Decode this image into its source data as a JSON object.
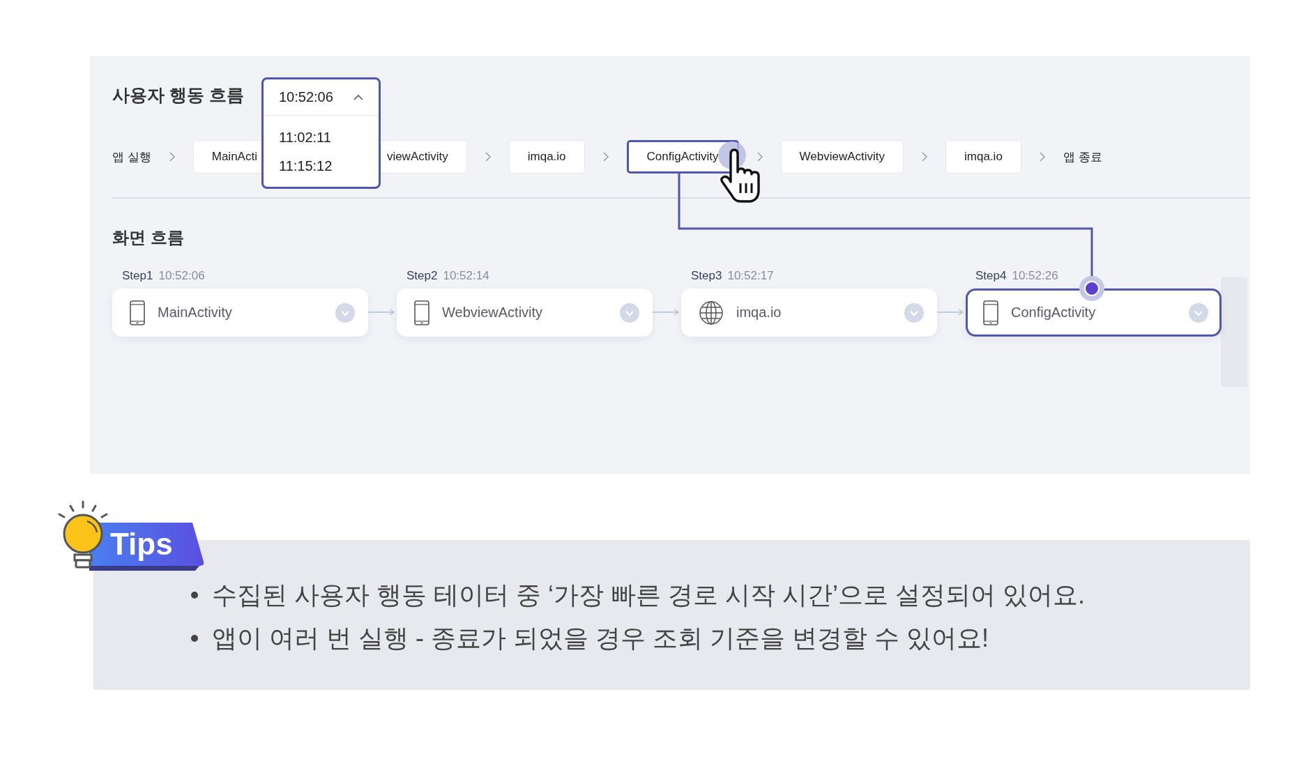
{
  "flow_panel": {
    "title": "사용자 행동 흐름",
    "time_select": {
      "value": "10:52:06",
      "expanded": true,
      "options": [
        {
          "label": "11:02:11",
          "selected": false
        },
        {
          "label": "11:15:12",
          "selected": false
        }
      ]
    },
    "action_flow": {
      "start": "앱 실행",
      "end": "앱 종료",
      "items": [
        {
          "label": "MainActi",
          "selected": false
        },
        {
          "label": "viewActivity",
          "selected": false
        },
        {
          "label": "imqa.io",
          "selected": false
        },
        {
          "label": "ConfigActivity",
          "selected": true
        },
        {
          "label": "WebviewActivity",
          "selected": false
        },
        {
          "label": "imqa.io",
          "selected": false
        }
      ]
    },
    "screen_flow": {
      "title": "화면 흐름",
      "steps": [
        {
          "step": "Step1",
          "time": "10:52:06",
          "name": "MainActivity",
          "kind": "app",
          "selected": false
        },
        {
          "step": "Step2",
          "time": "10:52:14",
          "name": "WebviewActivity",
          "kind": "app",
          "selected": false
        },
        {
          "step": "Step3",
          "time": "10:52:17",
          "name": "imqa.io",
          "kind": "web",
          "selected": false
        },
        {
          "step": "Step4",
          "time": "10:52:26",
          "name": "ConfigActivity",
          "kind": "app",
          "selected": true
        }
      ]
    }
  },
  "tips": {
    "badge": "Tips",
    "items": [
      "수집된 사용자 행동 테이터 중 ‘가장 빠른 경로 시작 시간’으로 설정되어 있어요.",
      "앱이 여러 번 실행 - 종료가 되었을 경우 조회 기준을 변경할 수 있어요!"
    ]
  }
}
